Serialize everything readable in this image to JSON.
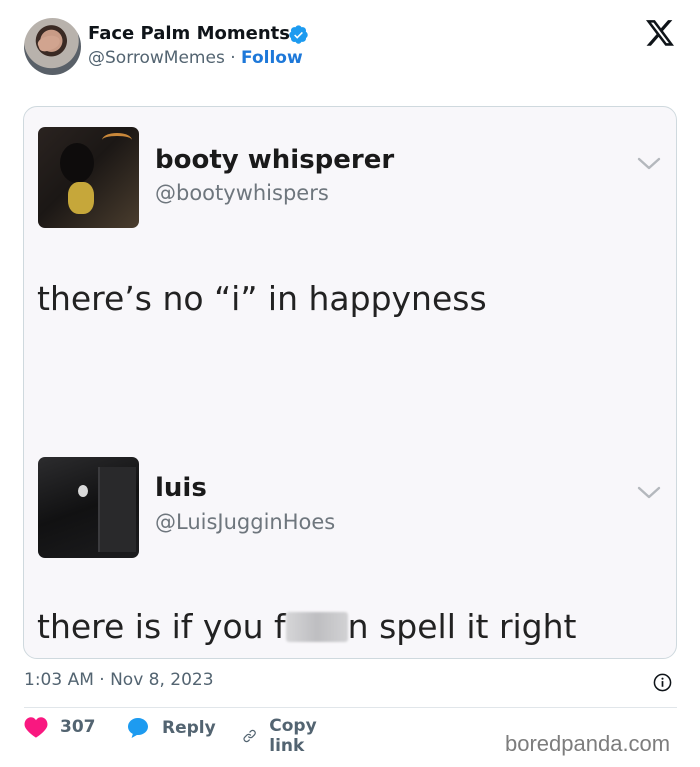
{
  "header": {
    "display_name": "Face Palm Moments",
    "handle": "@SorrowMemes",
    "separator": "·",
    "follow_label": "Follow"
  },
  "embedded_screenshot": {
    "tweets": [
      {
        "name": "booty whisperer",
        "handle": "@bootywhispers",
        "text": "there’s no “i” in happyness"
      },
      {
        "name": "luis",
        "handle": "@LuisJugginHoes",
        "text_before": "there is if you f",
        "text_after": "n spell it right"
      }
    ]
  },
  "timestamp": "1:03 AM · Nov 8, 2023",
  "actions": {
    "like_count": "307",
    "reply_label": "Reply",
    "copy_link_label": "Copy link"
  },
  "watermark": "boredpanda.com",
  "colors": {
    "like_red": "#f91880",
    "reply_blue": "#1d9bf0",
    "follow_blue": "#1d78d9",
    "verified_blue": "#1d9bf0"
  },
  "icons": [
    "x-logo-icon",
    "verified-badge-icon",
    "chevron-down-icon",
    "info-icon",
    "heart-icon",
    "reply-bubble-icon",
    "link-icon"
  ]
}
